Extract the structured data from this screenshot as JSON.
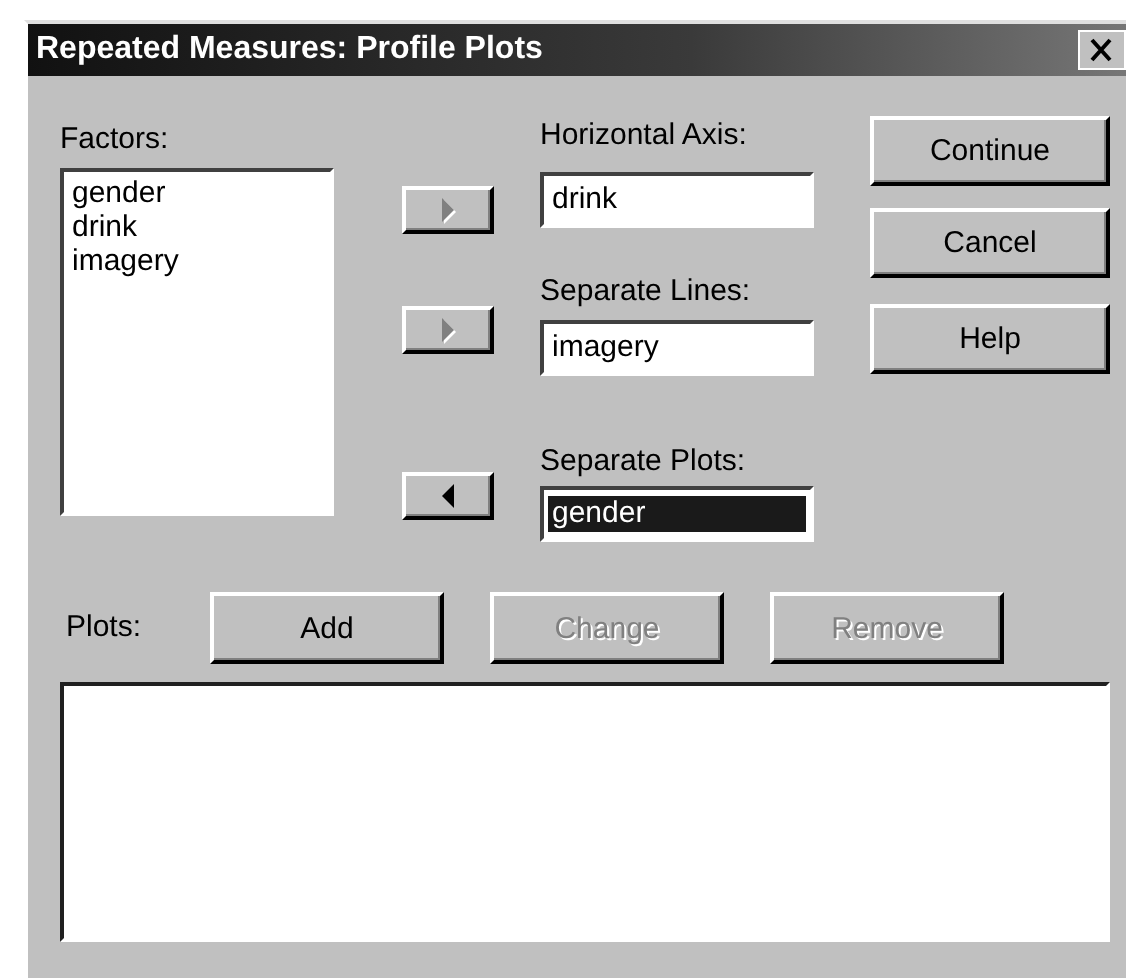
{
  "window": {
    "title": "Repeated Measures: Profile Plots"
  },
  "factors": {
    "label": "Factors:",
    "items": [
      "gender",
      "drink",
      "imagery"
    ]
  },
  "move_buttons": [
    {
      "kind": "right",
      "disabled": true
    },
    {
      "kind": "right",
      "disabled": true
    },
    {
      "kind": "left",
      "disabled": false
    }
  ],
  "targets": [
    {
      "label": "Horizontal Axis:",
      "value": "drink",
      "selected": false
    },
    {
      "label": "Separate Lines:",
      "value": "imagery",
      "selected": false
    },
    {
      "label": "Separate Plots:",
      "value": "gender",
      "selected": true
    }
  ],
  "side_buttons": [
    {
      "label": "Continue",
      "disabled": false
    },
    {
      "label": "Cancel",
      "disabled": false
    },
    {
      "label": "Help",
      "disabled": false
    }
  ],
  "plots": {
    "label": "Plots:",
    "buttons": [
      {
        "label": "Add",
        "disabled": false
      },
      {
        "label": "Change",
        "disabled": true
      },
      {
        "label": "Remove",
        "disabled": true
      }
    ]
  }
}
